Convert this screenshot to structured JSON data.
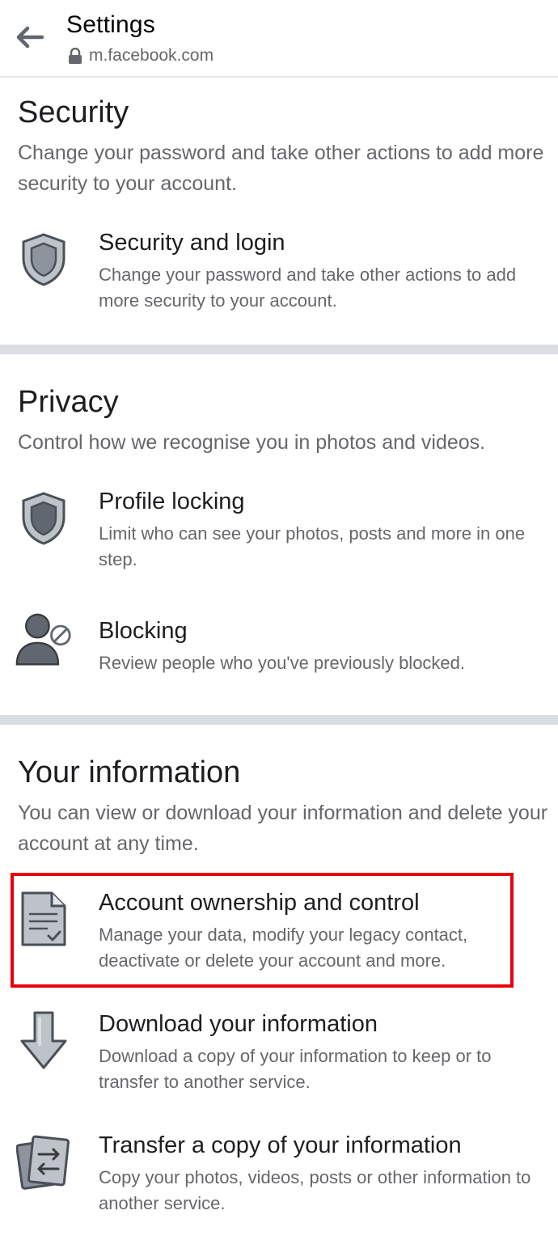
{
  "header": {
    "title": "Settings",
    "url": "m.facebook.com"
  },
  "security": {
    "title": "Security",
    "description": "Change your password and take other actions to add more security to your account.",
    "items": [
      {
        "title": "Security and login",
        "description": "Change your password and take other actions to add more security to your account.",
        "icon": "shield-icon"
      }
    ]
  },
  "privacy": {
    "title": "Privacy",
    "description": "Control how we recognise you in photos and videos.",
    "items": [
      {
        "title": "Profile locking",
        "description": "Limit who can see your photos, posts and more in one step.",
        "icon": "shield-lock-icon"
      },
      {
        "title": "Blocking",
        "description": "Review people who you've previously blocked.",
        "icon": "blocked-user-icon"
      }
    ]
  },
  "your_information": {
    "title": "Your information",
    "description": "You can view or download your information and delete your account at any time.",
    "items": [
      {
        "title": "Account ownership and control",
        "description": "Manage your data, modify your legacy contact, deactivate or delete your account and more.",
        "icon": "document-check-icon"
      },
      {
        "title": "Download your information",
        "description": "Download a copy of your information to keep or to transfer to another service.",
        "icon": "download-arrow-icon"
      },
      {
        "title": "Transfer a copy of your information",
        "description": "Copy your photos, videos, posts or other information to another service.",
        "icon": "transfer-icon"
      }
    ]
  },
  "colors": {
    "highlight": "#e8000b",
    "divider": "#dadde1",
    "icon_gray": "#606770"
  }
}
